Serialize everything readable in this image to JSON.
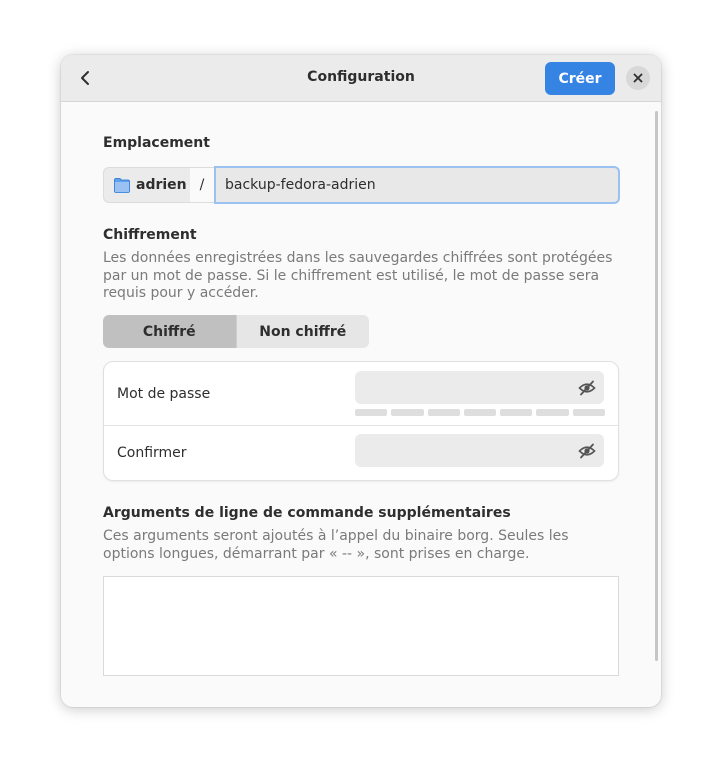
{
  "header": {
    "title": "Configuration",
    "create_label": "Créer"
  },
  "location": {
    "section_title": "Emplacement",
    "folder_label": "adrien",
    "separator": "/",
    "name_value": "backup-fedora-adrien"
  },
  "encryption": {
    "section_title": "Chiffrement",
    "description": "Les données enregistrées dans les sauvegardes chiffrées sont protégées par un mot de passe. Si le chiffrement est utilisé, le mot de passe sera requis pour y accéder.",
    "options": [
      "Chiffré",
      "Non chiffré"
    ],
    "selected": "Chiffré",
    "password_label": "Mot de passe",
    "password_value": "",
    "confirm_label": "Confirmer",
    "confirm_value": "",
    "strength_segments": 7,
    "strength_level": 0
  },
  "arguments": {
    "section_title": "Arguments de ligne de commande supplémentaires",
    "description": "Ces arguments seront ajoutés à l’appel du binaire borg. Seules les options longues, démarrant par « -- », sont prises en charge.",
    "value": ""
  },
  "icons": {
    "back": "chevron-left-icon",
    "close": "close-icon",
    "folder": "folder-icon",
    "reveal": "eye-hidden-icon"
  },
  "colors": {
    "accent": "#3584e4",
    "focus": "#99c1f1"
  }
}
